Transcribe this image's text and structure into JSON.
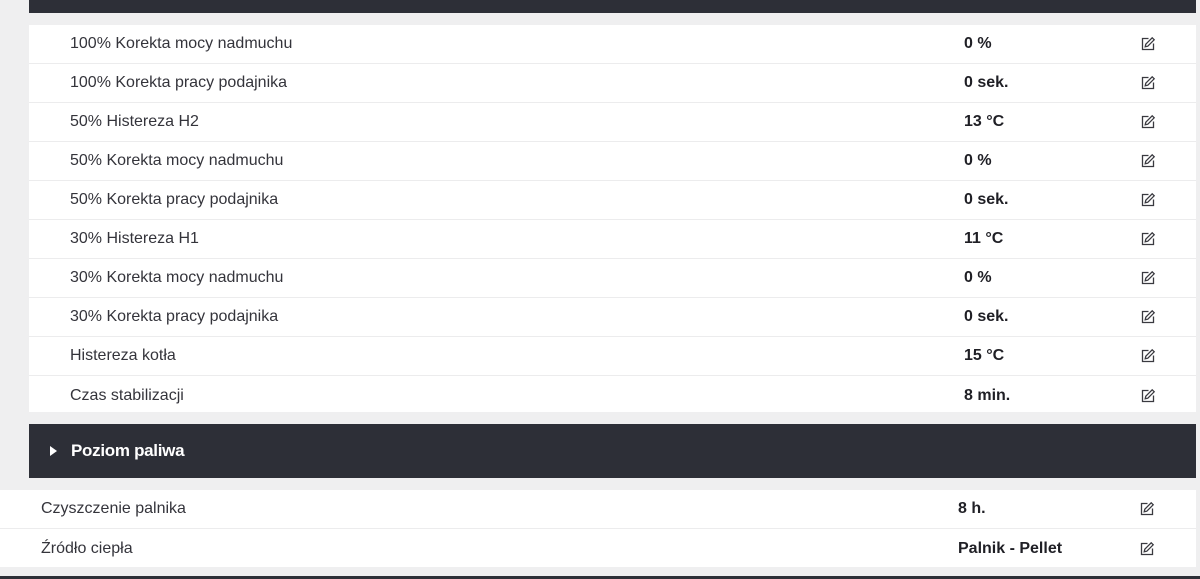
{
  "inner_rows": [
    {
      "label": "100% Korekta mocy nadmuchu",
      "value": "0 %"
    },
    {
      "label": "100% Korekta pracy podajnika",
      "value": "0 sek."
    },
    {
      "label": "50% Histereza H2",
      "value": "13 °C"
    },
    {
      "label": "50% Korekta mocy nadmuchu",
      "value": "0 %"
    },
    {
      "label": "50% Korekta pracy podajnika",
      "value": "0 sek."
    },
    {
      "label": "30% Histereza H1",
      "value": "11 °C"
    },
    {
      "label": "30% Korekta mocy nadmuchu",
      "value": "0 %"
    },
    {
      "label": "30% Korekta pracy podajnika",
      "value": "0 sek."
    },
    {
      "label": "Histereza kotła",
      "value": "15 °C"
    },
    {
      "label": "Czas stabilizacji",
      "value": "8 min."
    }
  ],
  "section": {
    "title": "Poziom paliwa",
    "icon": "caret-right-icon"
  },
  "outer_rows": [
    {
      "label": "Czyszczenie palnika",
      "value": "8 h."
    },
    {
      "label": "Źródło ciepła",
      "value": "Palnik - Pellet"
    }
  ],
  "icons": {
    "edit": "edit-icon"
  },
  "colors": {
    "header_bg": "#2d2f37",
    "page_bg": "#efeff0",
    "row_bg": "#ffffff",
    "text": "#34343b"
  }
}
